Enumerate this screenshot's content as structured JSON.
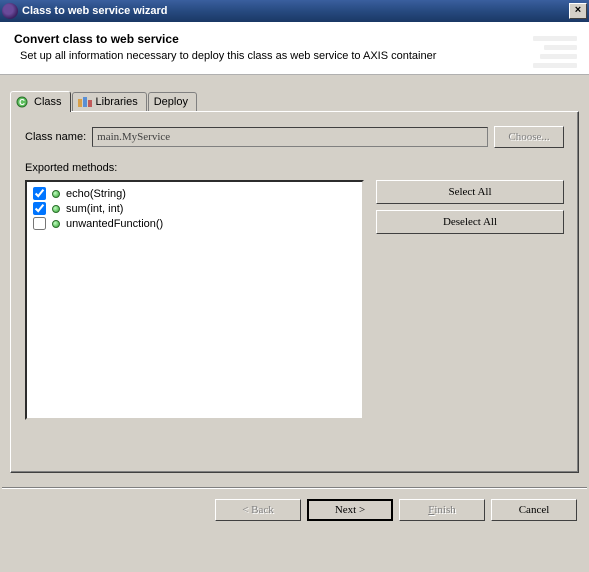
{
  "titlebar": {
    "title": "Class to web service wizard",
    "close_label": "×"
  },
  "header": {
    "title": "Convert class to web service",
    "description": "Set up all information necessary to deploy this class as web service to AXIS container"
  },
  "tabs": {
    "class": "Class",
    "libraries": "Libraries",
    "deploy": "Deploy"
  },
  "form": {
    "class_name_label": "Class name:",
    "class_name_value": "main.MyService",
    "choose_label": "Choose...",
    "exported_label": "Exported methods:",
    "select_all_label": "Select All",
    "deselect_all_label": "Deselect All"
  },
  "methods": [
    {
      "checked": true,
      "name": "echo(String)"
    },
    {
      "checked": true,
      "name": "sum(int, int)"
    },
    {
      "checked": false,
      "name": "unwantedFunction()"
    }
  ],
  "footer": {
    "back": "< Back",
    "next": "Next >",
    "finish": "Finish",
    "cancel": "Cancel"
  }
}
